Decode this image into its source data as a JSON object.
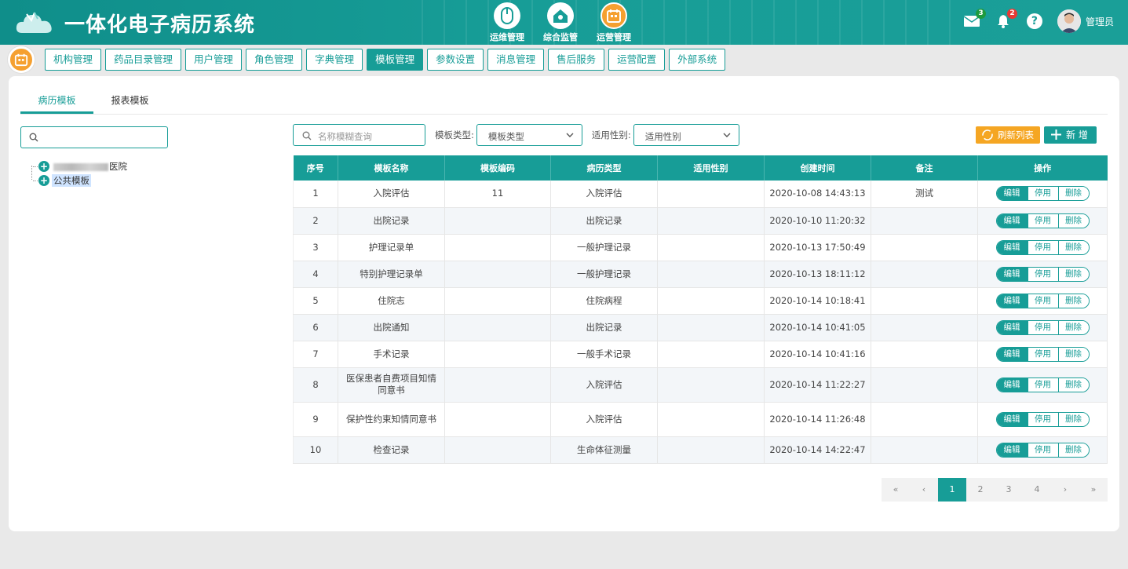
{
  "app": {
    "title": "一体化电子病历系统"
  },
  "top_nav": [
    {
      "label": "运维管理",
      "icon": "mouse-icon"
    },
    {
      "label": "综合监管",
      "icon": "home-monitor-icon"
    },
    {
      "label": "运营管理",
      "icon": "calendar-icon"
    }
  ],
  "header": {
    "mail_count": "3",
    "bell_count": "2",
    "help": "?",
    "username": "管理员"
  },
  "menu": [
    "机构管理",
    "药品目录管理",
    "用户管理",
    "角色管理",
    "字典管理",
    "模板管理",
    "参数设置",
    "消息管理",
    "售后服务",
    "运营配置",
    "外部系统"
  ],
  "menu_active": "模板管理",
  "tabs": [
    "病历模板",
    "报表模板"
  ],
  "tree": {
    "search_placeholder": "",
    "nodes": [
      {
        "label": "医院",
        "blurred_prefix": true
      },
      {
        "label": "公共模板",
        "selected": true
      }
    ]
  },
  "filters": {
    "name_placeholder": "名称模糊查询",
    "type_label": "模板类型:",
    "type_value": "模板类型",
    "gender_label": "适用性别:",
    "gender_value": "适用性别"
  },
  "buttons": {
    "refresh": "刷新列表",
    "add": "新 增"
  },
  "table": {
    "headers": [
      "序号",
      "模板名称",
      "模板编码",
      "病历类型",
      "适用性别",
      "创建时间",
      "备注",
      "操作"
    ],
    "op_labels": [
      "编辑",
      "停用",
      "删除"
    ],
    "rows": [
      [
        "1",
        "入院评估",
        "11",
        "入院评估",
        "",
        "2020-10-08 14:43:13",
        "测试"
      ],
      [
        "2",
        "出院记录",
        "",
        "出院记录",
        "",
        "2020-10-10 11:20:32",
        ""
      ],
      [
        "3",
        "护理记录单",
        "",
        "一般护理记录",
        "",
        "2020-10-13 17:50:49",
        ""
      ],
      [
        "4",
        "特别护理记录单",
        "",
        "一般护理记录",
        "",
        "2020-10-13 18:11:12",
        ""
      ],
      [
        "5",
        "住院志",
        "",
        "住院病程",
        "",
        "2020-10-14 10:18:41",
        ""
      ],
      [
        "6",
        "出院通知",
        "",
        "出院记录",
        "",
        "2020-10-14 10:41:05",
        ""
      ],
      [
        "7",
        "手术记录",
        "",
        "一般手术记录",
        "",
        "2020-10-14 10:41:16",
        ""
      ],
      [
        "8",
        "医保患者自费项目知情同意书",
        "",
        "入院评估",
        "",
        "2020-10-14 11:22:27",
        ""
      ],
      [
        "9",
        "保护性约束知情同意书",
        "",
        "入院评估",
        "",
        "2020-10-14 11:26:48",
        ""
      ],
      [
        "10",
        "检查记录",
        "",
        "生命体征测量",
        "",
        "2020-10-14 14:22:47",
        ""
      ]
    ]
  },
  "pagination": {
    "items": [
      "«",
      "‹",
      "1",
      "2",
      "3",
      "4",
      "›",
      "»"
    ],
    "current": "1"
  },
  "colors": {
    "primary": "#179d97",
    "accent": "#f5a623"
  }
}
